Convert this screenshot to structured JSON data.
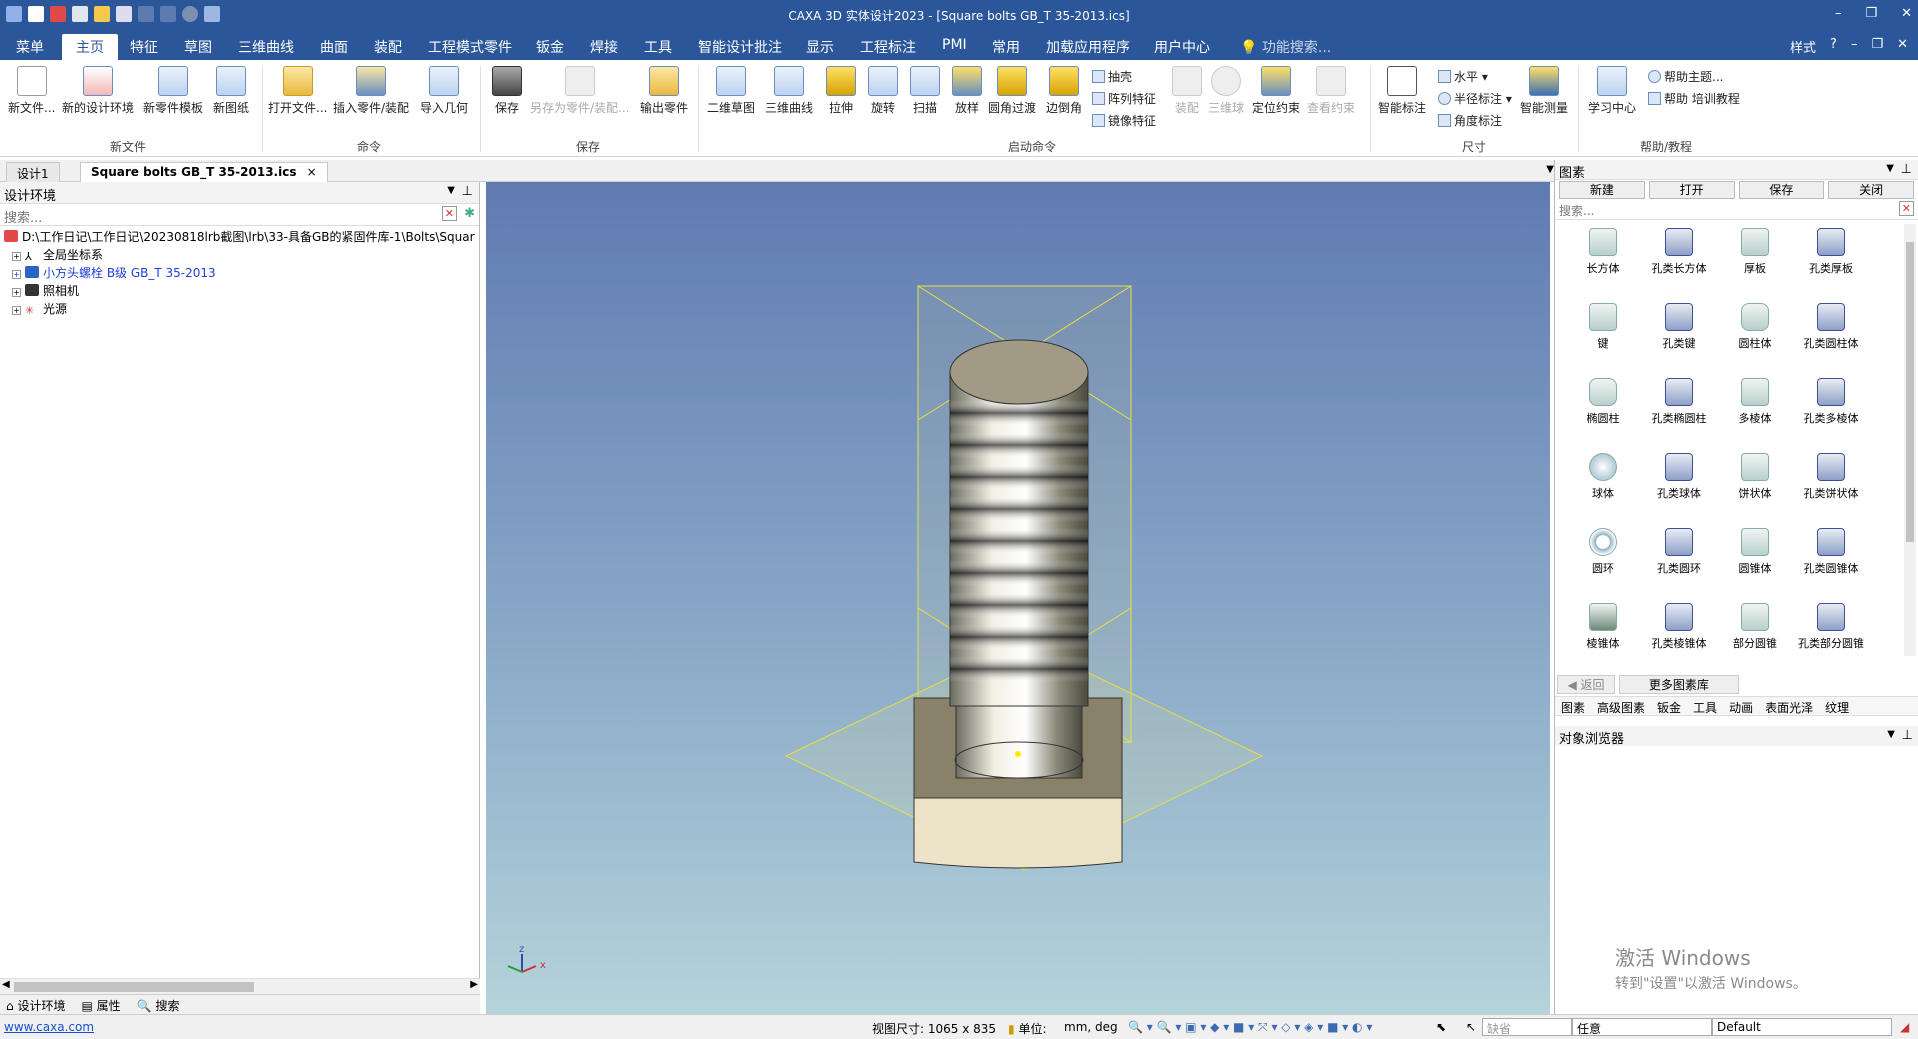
{
  "window": {
    "title": "CAXA 3D 实体设计2023 - [Square bolts GB_T 35-2013.ics]"
  },
  "menu": {
    "items": [
      "菜单",
      "主页",
      "特征",
      "草图",
      "三维曲线",
      "曲面",
      "装配",
      "工程模式零件",
      "钣金",
      "焊接",
      "工具",
      "智能设计批注",
      "显示",
      "工程标注",
      "PMI",
      "常用",
      "加载应用程序",
      "用户中心"
    ],
    "search_placeholder": "功能搜索...",
    "style": "样式"
  },
  "ribbon": {
    "new_file": {
      "label": "新文件...",
      "group": "新文件"
    },
    "new_design": "新的设计环境",
    "new_part_template": "新零件模板",
    "new_drawing": "新图纸",
    "open_file": "打开文件...",
    "insert_part": "插入零件/装配",
    "import_geom": "导入几何",
    "command_group": "命令",
    "save": "保存",
    "save_as": "另存为零件/装配...",
    "export_part": "输出零件",
    "save_group": "保存",
    "sketch2d": "二维草图",
    "curve3d": "三维曲线",
    "extrude": "拉伸",
    "revolve": "旋转",
    "sweep": "扫描",
    "loft": "放样",
    "fillet": "圆角过渡",
    "chamfer": "边倒角",
    "shell": "抽壳",
    "pattern": "阵列特征",
    "mirror": "镜像特征",
    "assembly": "装配",
    "ball3d": "三维球",
    "locate": "定位约束",
    "view_constraint": "查看约束",
    "launch_group": "启动命令",
    "smart_dim": "智能标注",
    "horizontal": "水平",
    "radius_dim": "半径标注",
    "angle_dim": "角度标注",
    "measure": "智能测量",
    "size_group": "尺寸",
    "learning": "学习中心",
    "help_topics": "帮助主题...",
    "help_training": "帮助 培训教程",
    "help_group": "帮助/教程"
  },
  "tabs": {
    "design": "设计1",
    "active": "Square bolts GB_T 35-2013.ics"
  },
  "left": {
    "title": "设计环境",
    "search_placeholder": "搜索...",
    "tree": [
      {
        "label": "D:\\工作日记\\工作日记\\20230818lrb截图\\lrb\\33-具备GB的紧固件库-1\\Bolts\\Square bolts GB_T 35-2013.ics"
      },
      {
        "label": "全局坐标系"
      },
      {
        "label": "小方头螺栓 B级 GB_T 35-2013"
      },
      {
        "label": "照相机"
      },
      {
        "label": "光源"
      }
    ],
    "bottom_tabs": [
      "设计环境",
      "属性",
      "搜索"
    ]
  },
  "right": {
    "title": "图素",
    "buttons": [
      "新建",
      "打开",
      "保存",
      "关闭"
    ],
    "search_placeholder": "搜索...",
    "library": [
      "长方体",
      "孔类长方体",
      "厚板",
      "孔类厚板",
      "键",
      "孔类键",
      "圆柱体",
      "孔类圆柱体",
      "椭圆柱",
      "孔类椭圆柱",
      "多棱体",
      "孔类多棱体",
      "球体",
      "孔类球体",
      "饼状体",
      "孔类饼状体",
      "圆环",
      "孔类圆环",
      "圆锥体",
      "孔类圆锥体",
      "棱锥体",
      "孔类棱锥体",
      "部分圆锥",
      "孔类部分圆锥"
    ],
    "back": "返回",
    "more": "更多图素库",
    "tabs": [
      "图素",
      "高级图素",
      "钣金",
      "工具",
      "动画",
      "表面光泽",
      "纹理"
    ],
    "object_browser": "对象浏览器",
    "watermark_line1": "激活 Windows",
    "watermark_line2": "转到\"设置\"以激活 Windows。"
  },
  "status": {
    "url": "www.caxa.com",
    "view_size": "视图尺寸: 1065 x  835",
    "unit_label": "单位:",
    "unit_value": "mm, deg",
    "combo1": "缺省",
    "combo2": "任意",
    "combo3": "Default"
  },
  "axis": {
    "z": "z",
    "x": "x"
  }
}
